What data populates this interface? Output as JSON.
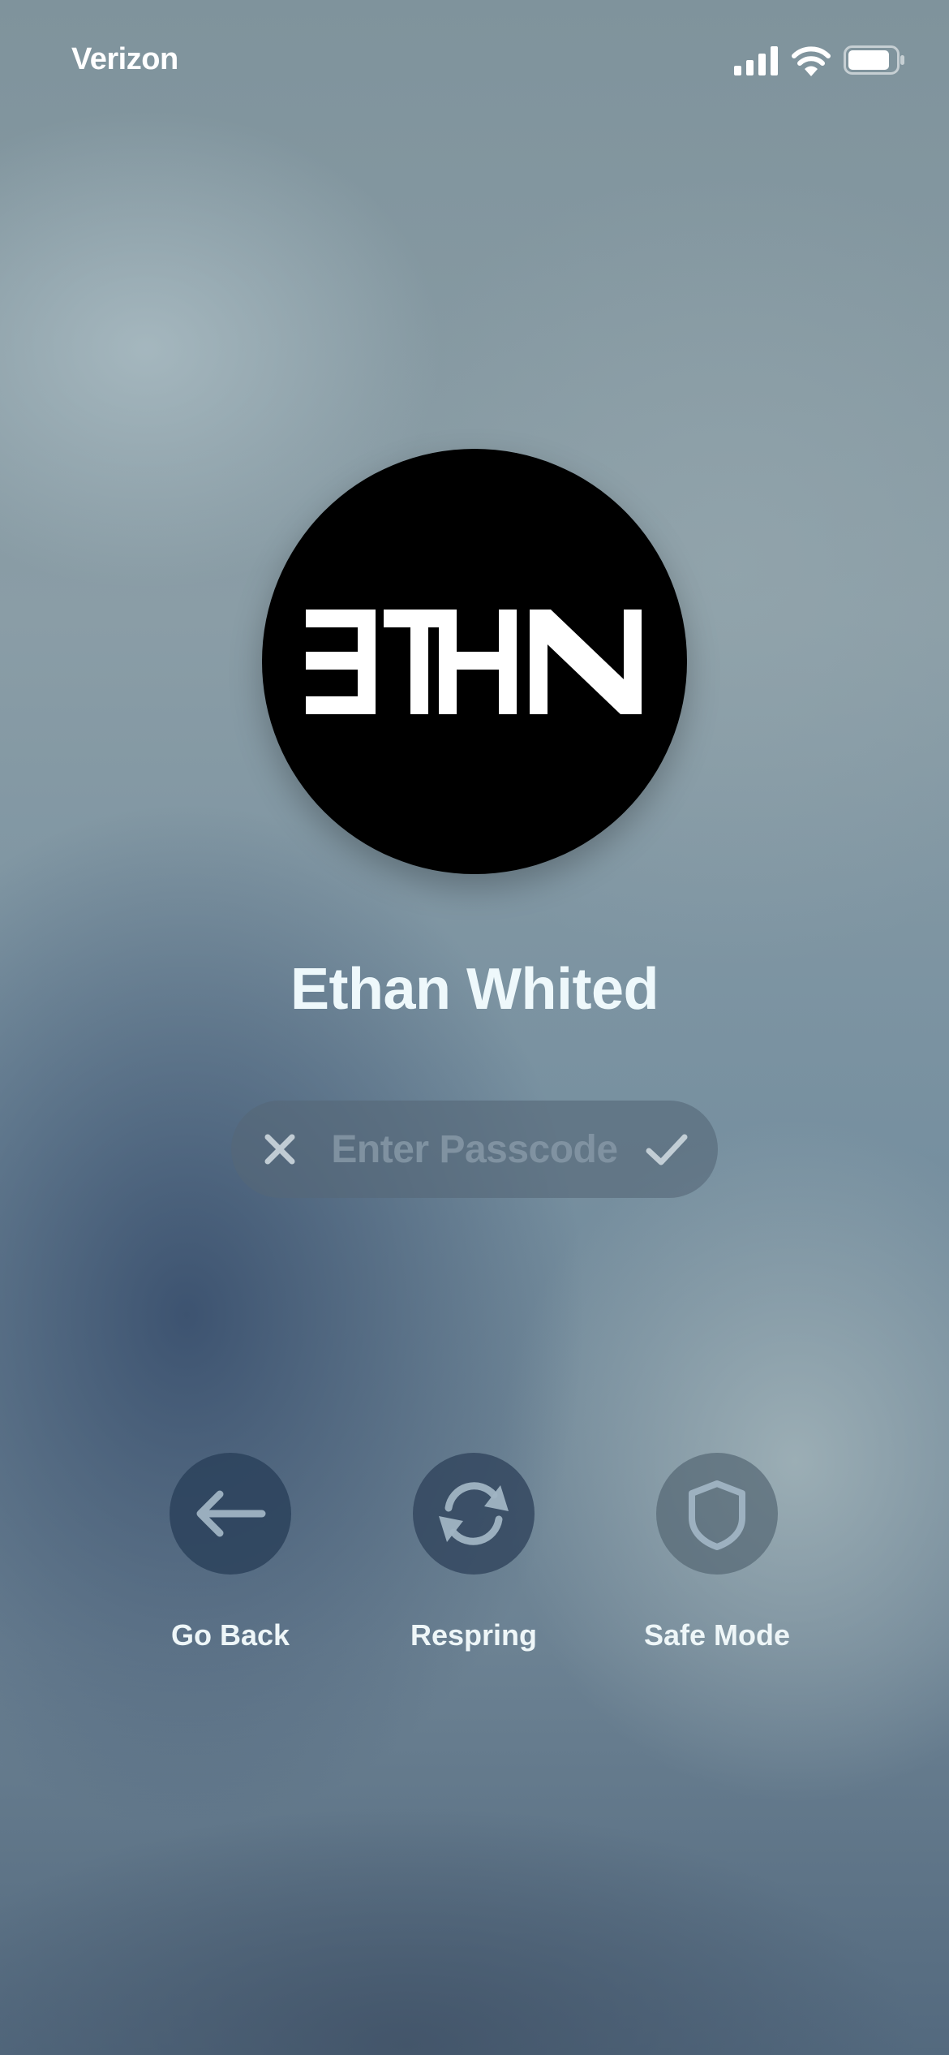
{
  "status_bar": {
    "carrier": "Verizon",
    "icons": [
      "cellular-signal-icon",
      "wifi-icon",
      "battery-icon"
    ]
  },
  "profile": {
    "avatar_text": "ETHN",
    "name": "Ethan Whited"
  },
  "passcode": {
    "placeholder": "Enter Passcode",
    "value": "",
    "clear_icon": "x-icon",
    "confirm_icon": "checkmark-icon"
  },
  "actions": [
    {
      "label": "Go Back",
      "icon": "arrow-left-icon"
    },
    {
      "label": "Respring",
      "icon": "refresh-icon"
    },
    {
      "label": "Safe Mode",
      "icon": "shield-icon"
    }
  ],
  "colors": {
    "text": "#ffffff",
    "avatar_bg": "#000000",
    "pill_bg": "#566878",
    "placeholder": "#8294a2"
  }
}
